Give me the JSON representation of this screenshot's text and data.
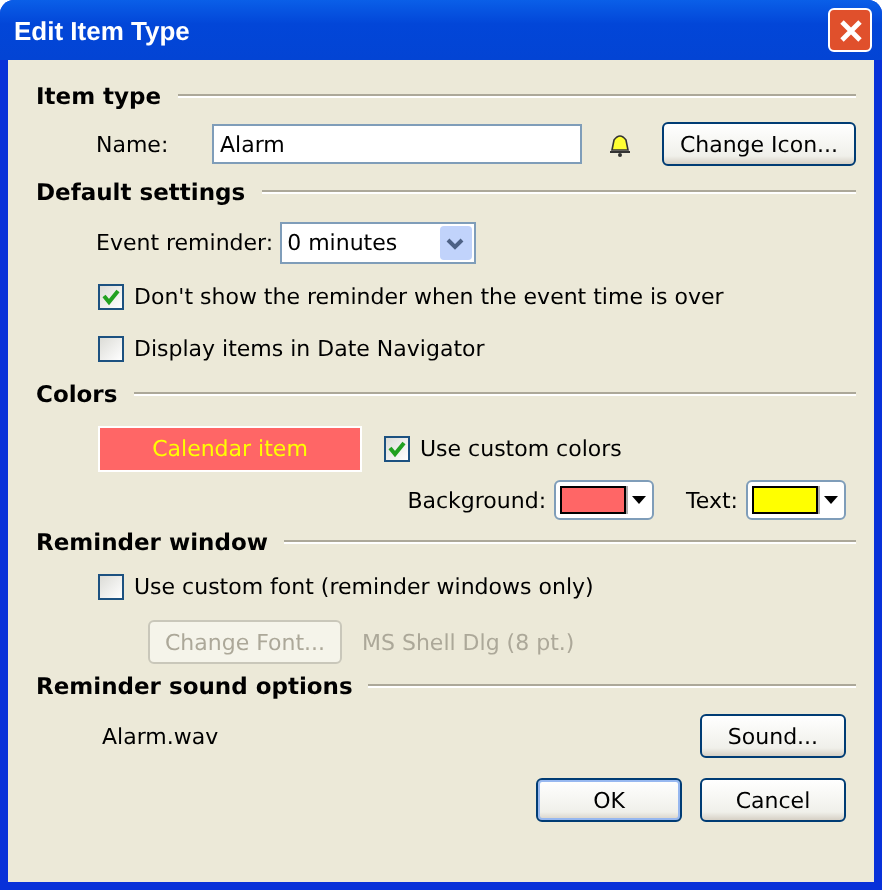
{
  "window": {
    "title": "Edit Item Type"
  },
  "item_type": {
    "heading": "Item type",
    "name_label": "Name:",
    "name_value": "Alarm",
    "change_icon_button": "Change Icon..."
  },
  "default_settings": {
    "heading": "Default settings",
    "reminder_label": "Event reminder:",
    "reminder_value": "0 minutes",
    "options": [
      {
        "label": "Don't show the reminder when the event time is over",
        "checked": true
      },
      {
        "label": "Display items in Date Navigator",
        "checked": false
      }
    ]
  },
  "colors": {
    "heading": "Colors",
    "preview": "Calendar item",
    "custom": {
      "label": "Use custom colors",
      "checked": true
    },
    "pickers": [
      {
        "label": "Background:",
        "color": "#ff6666"
      },
      {
        "label": "Text:",
        "color": "#ffff00"
      }
    ]
  },
  "reminder_window": {
    "heading": "Reminder window",
    "custom_font": {
      "label": "Use custom font (reminder windows only)",
      "checked": false
    },
    "change_font_button": {
      "label": "Change Font...",
      "disabled": true
    },
    "font_name": "MS Shell Dlg (8 pt.)"
  },
  "sound": {
    "heading": "Reminder sound options",
    "file": "Alarm.wav",
    "button": "Sound..."
  },
  "buttons": [
    {
      "label": "OK",
      "default": true
    },
    {
      "label": "Cancel",
      "default": false
    }
  ]
}
